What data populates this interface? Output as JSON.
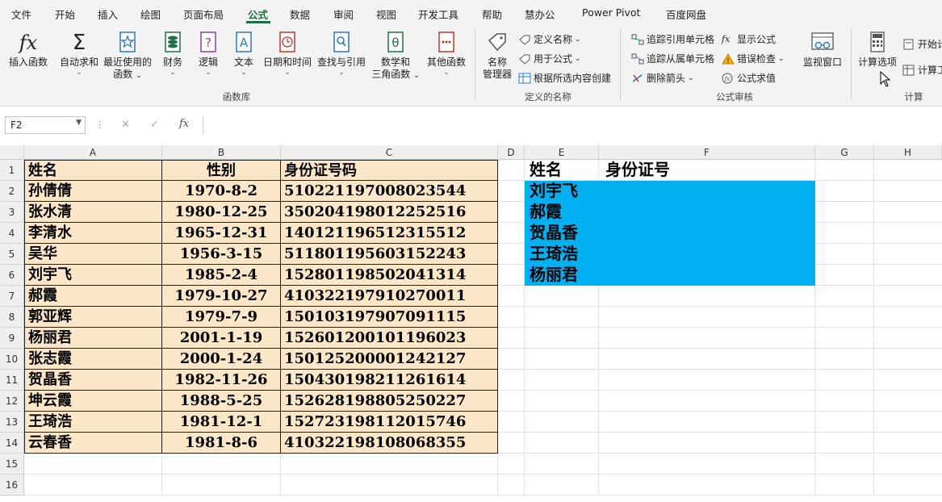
{
  "menu": {
    "tabs": [
      "文件",
      "开始",
      "插入",
      "绘图",
      "页面布局",
      "公式",
      "数据",
      "审阅",
      "视图",
      "开发工具",
      "帮助",
      "慧办公",
      "Power Pivot",
      "百度网盘"
    ],
    "active": "公式"
  },
  "ribbon": {
    "function_library": {
      "label": "函数库",
      "insert_function": "插入函数",
      "autosum": "自动求和",
      "recent_line1": "最近使用的",
      "recent_line2": "函数",
      "financial": "财务",
      "logical": "逻辑",
      "text": "文本",
      "datetime": "日期和时间",
      "lookup": "查找与引用",
      "math_line1": "数学和",
      "math_line2": "三角函数",
      "more": "其他函数"
    },
    "defined_names": {
      "label": "定义的名称",
      "name_manager_line1": "名称",
      "name_manager_line2": "管理器",
      "define_name": "定义名称",
      "use_in_formula": "用于公式",
      "create_from_selection": "根据所选内容创建"
    },
    "formula_auditing": {
      "label": "公式审核",
      "trace_precedents": "追踪引用单元格",
      "trace_dependents": "追踪从属单元格",
      "remove_arrows": "删除箭头",
      "show_formulas": "显示公式",
      "error_checking": "错误检查",
      "evaluate_formula": "公式求值",
      "watch_window": "监视窗口"
    },
    "calculation": {
      "label": "计算",
      "options": "计算选项",
      "calc_now": "开始计",
      "calc_sheet": "计算工"
    }
  },
  "formula_bar": {
    "name_box": "F2",
    "cancel": "✕",
    "enter": "✓",
    "fx": "fx",
    "content": ""
  },
  "columns": [
    "A",
    "B",
    "C",
    "D",
    "E",
    "F",
    "G",
    "H"
  ],
  "rows": [
    "1",
    "2",
    "3",
    "4",
    "5",
    "6",
    "7",
    "8",
    "9",
    "10",
    "11",
    "12",
    "13",
    "14",
    "15",
    "16"
  ],
  "table": {
    "headers": [
      "姓名",
      "性别",
      "身份证号码"
    ],
    "records": [
      [
        "孙倩倩",
        "1970-8-2",
        "510221197008023544"
      ],
      [
        "张水清",
        "1980-12-25",
        "350204198012252516"
      ],
      [
        "李清水",
        "1965-12-31",
        "140121196512315512"
      ],
      [
        "吴华",
        "1956-3-15",
        "511801195603152243"
      ],
      [
        "刘宇飞",
        "1985-2-4",
        "152801198502041314"
      ],
      [
        "郝霞",
        "1979-10-27",
        "410322197910270011"
      ],
      [
        "郭亚辉",
        "1979-7-9",
        "150103197907091115"
      ],
      [
        "杨丽君",
        "2001-1-19",
        "152601200101196023"
      ],
      [
        "张志霞",
        "2000-1-24",
        "150125200001242127"
      ],
      [
        "贺晶香",
        "1982-11-26",
        "150430198211261614"
      ],
      [
        "坤云霞",
        "1988-5-25",
        "152628198805250227"
      ],
      [
        "王琦浩",
        "1981-12-1",
        "152723198112015746"
      ],
      [
        "云春香",
        "1981-8-6",
        "410322198108068355"
      ]
    ]
  },
  "lookup": {
    "header_name": "姓名",
    "header_id": "身份证号",
    "names": [
      "刘宇飞",
      "郝霞",
      "贺晶香",
      "王琦浩",
      "杨丽君"
    ]
  },
  "colors": {
    "accent": "#1e7145",
    "table_fill": "#fce8c8",
    "selection_fill": "#00b0f0"
  }
}
